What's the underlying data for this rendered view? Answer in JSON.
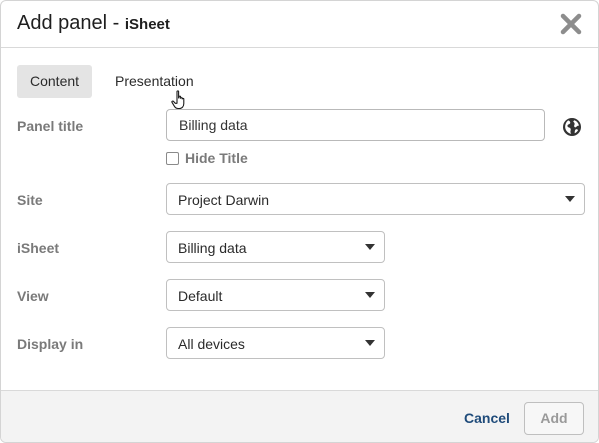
{
  "dialog": {
    "title": "Add panel",
    "separator": " - ",
    "subtitle": "iSheet"
  },
  "tabs": [
    {
      "label": "Content",
      "active": true
    },
    {
      "label": "Presentation",
      "active": false
    }
  ],
  "form": {
    "panel_title_label": "Panel title",
    "panel_title_value": "Billing data",
    "hide_title_label": "Hide Title",
    "hide_title_checked": false,
    "site_label": "Site",
    "site_value": "Project Darwin",
    "isheet_label": "iSheet",
    "isheet_value": "Billing data",
    "view_label": "View",
    "view_value": "Default",
    "display_label": "Display in",
    "display_value": "All devices"
  },
  "footer": {
    "cancel_label": "Cancel",
    "add_label": "Add"
  },
  "icons": {
    "close": "close-icon",
    "globe": "globe-icon",
    "caret": "chevron-down-icon",
    "cursor": "hand-pointer-icon"
  },
  "colors": {
    "link": "#1f4b7a",
    "label": "#7a7a7a",
    "tab_active_bg": "#e4e4e4",
    "footer_bg": "#f3f3f3"
  }
}
